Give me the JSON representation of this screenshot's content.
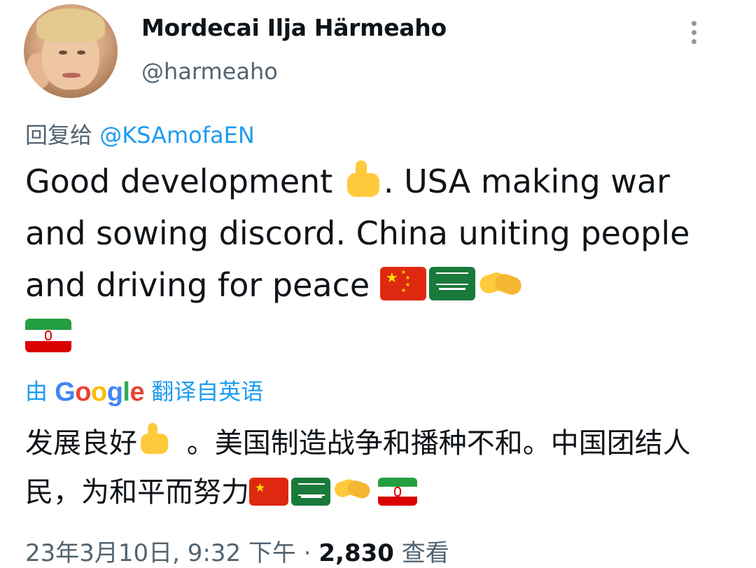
{
  "author": {
    "name": "Mordecai Ilja Härmeaho",
    "handle": "@harmeaho"
  },
  "reply": {
    "prefix": "回复给",
    "mention": "@KSAmofaEN"
  },
  "tweet": {
    "text_part1": "Good development ",
    "text_part2": ". USA making war and sowing discord. China uniting people and driving for peace ",
    "emoji": [
      "thumbs-up-icon",
      "china-flag-icon",
      "saudi-arabia-flag-icon",
      "handshake-icon",
      "iran-flag-icon"
    ]
  },
  "translation": {
    "prefix": "由",
    "provider": "Google",
    "suffix": "翻译自英语",
    "text_part1": "发展良好",
    "text_part2": " 。美国制造战争和播种不和。中国团结人民，为和平而努力"
  },
  "meta": {
    "timestamp": "23年3月10日, 9:32 下午",
    "separator": "·",
    "views_count": "2,830",
    "views_label": "查看"
  },
  "colors": {
    "link": "#1d9bf0",
    "secondary_text": "#536471",
    "primary_text": "#0f1419"
  }
}
